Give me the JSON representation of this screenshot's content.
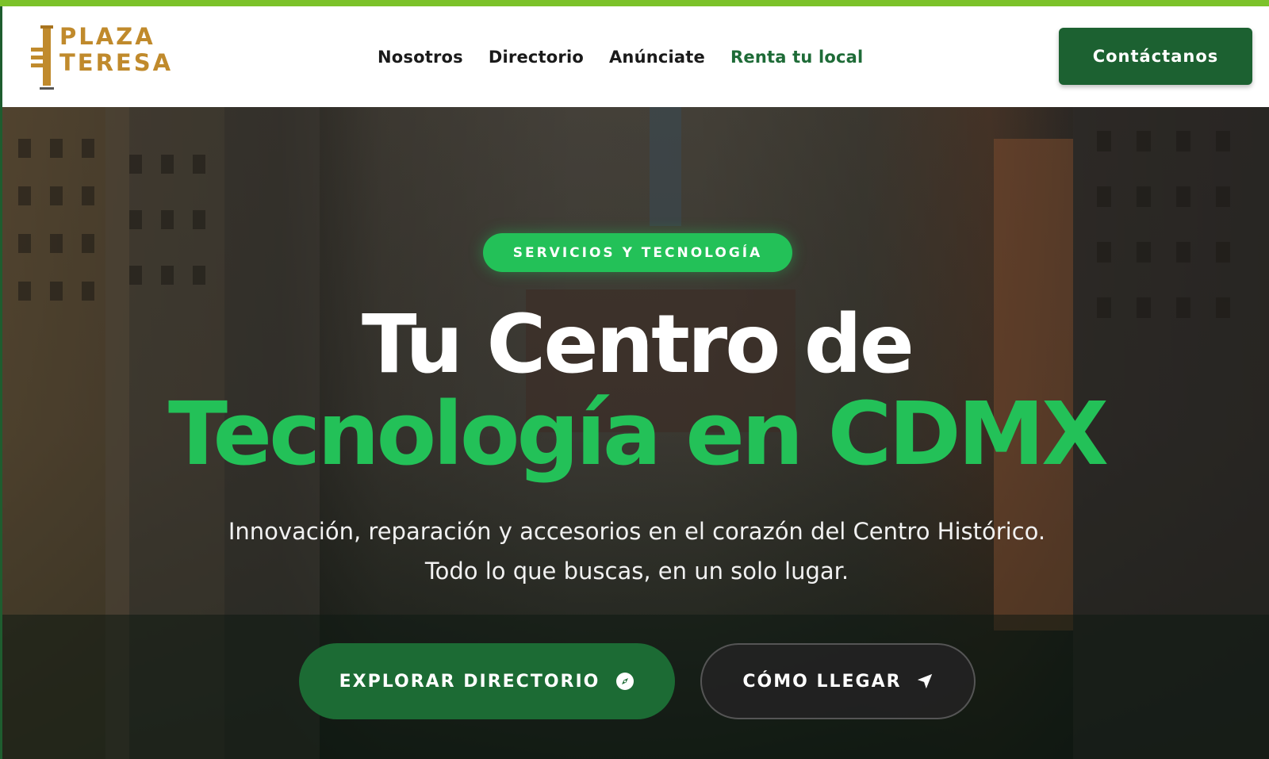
{
  "brand": {
    "logo_line1": "PLAZA",
    "logo_line2": "TERESA",
    "logo_mark_text": "TERESA",
    "accent": "#7cc22a",
    "gold": "#c08a2c",
    "green_dark": "#1c6131",
    "green_bright": "#23c158"
  },
  "nav": {
    "items": [
      {
        "label": "Nosotros"
      },
      {
        "label": "Directorio"
      },
      {
        "label": "Anúnciate"
      },
      {
        "label": "Renta tu local"
      }
    ],
    "active_item": "Renta tu local",
    "contact_label": "Contáctanos"
  },
  "hero": {
    "badge": "SERVICIOS Y TECNOLOGÍA",
    "title_line1": "Tu Centro de",
    "title_line2": "Tecnología en CDMX",
    "subtitle_line1": "Innovación, reparación y accesorios en el corazón del Centro Histórico.",
    "subtitle_line2": "Todo lo que buscas, en un solo lugar.",
    "primary_button": {
      "label": "EXPLORAR DIRECTORIO",
      "icon": "compass-icon"
    },
    "secondary_button": {
      "label": "CÓMO LLEGAR",
      "icon": "navigation-arrow-icon"
    }
  }
}
